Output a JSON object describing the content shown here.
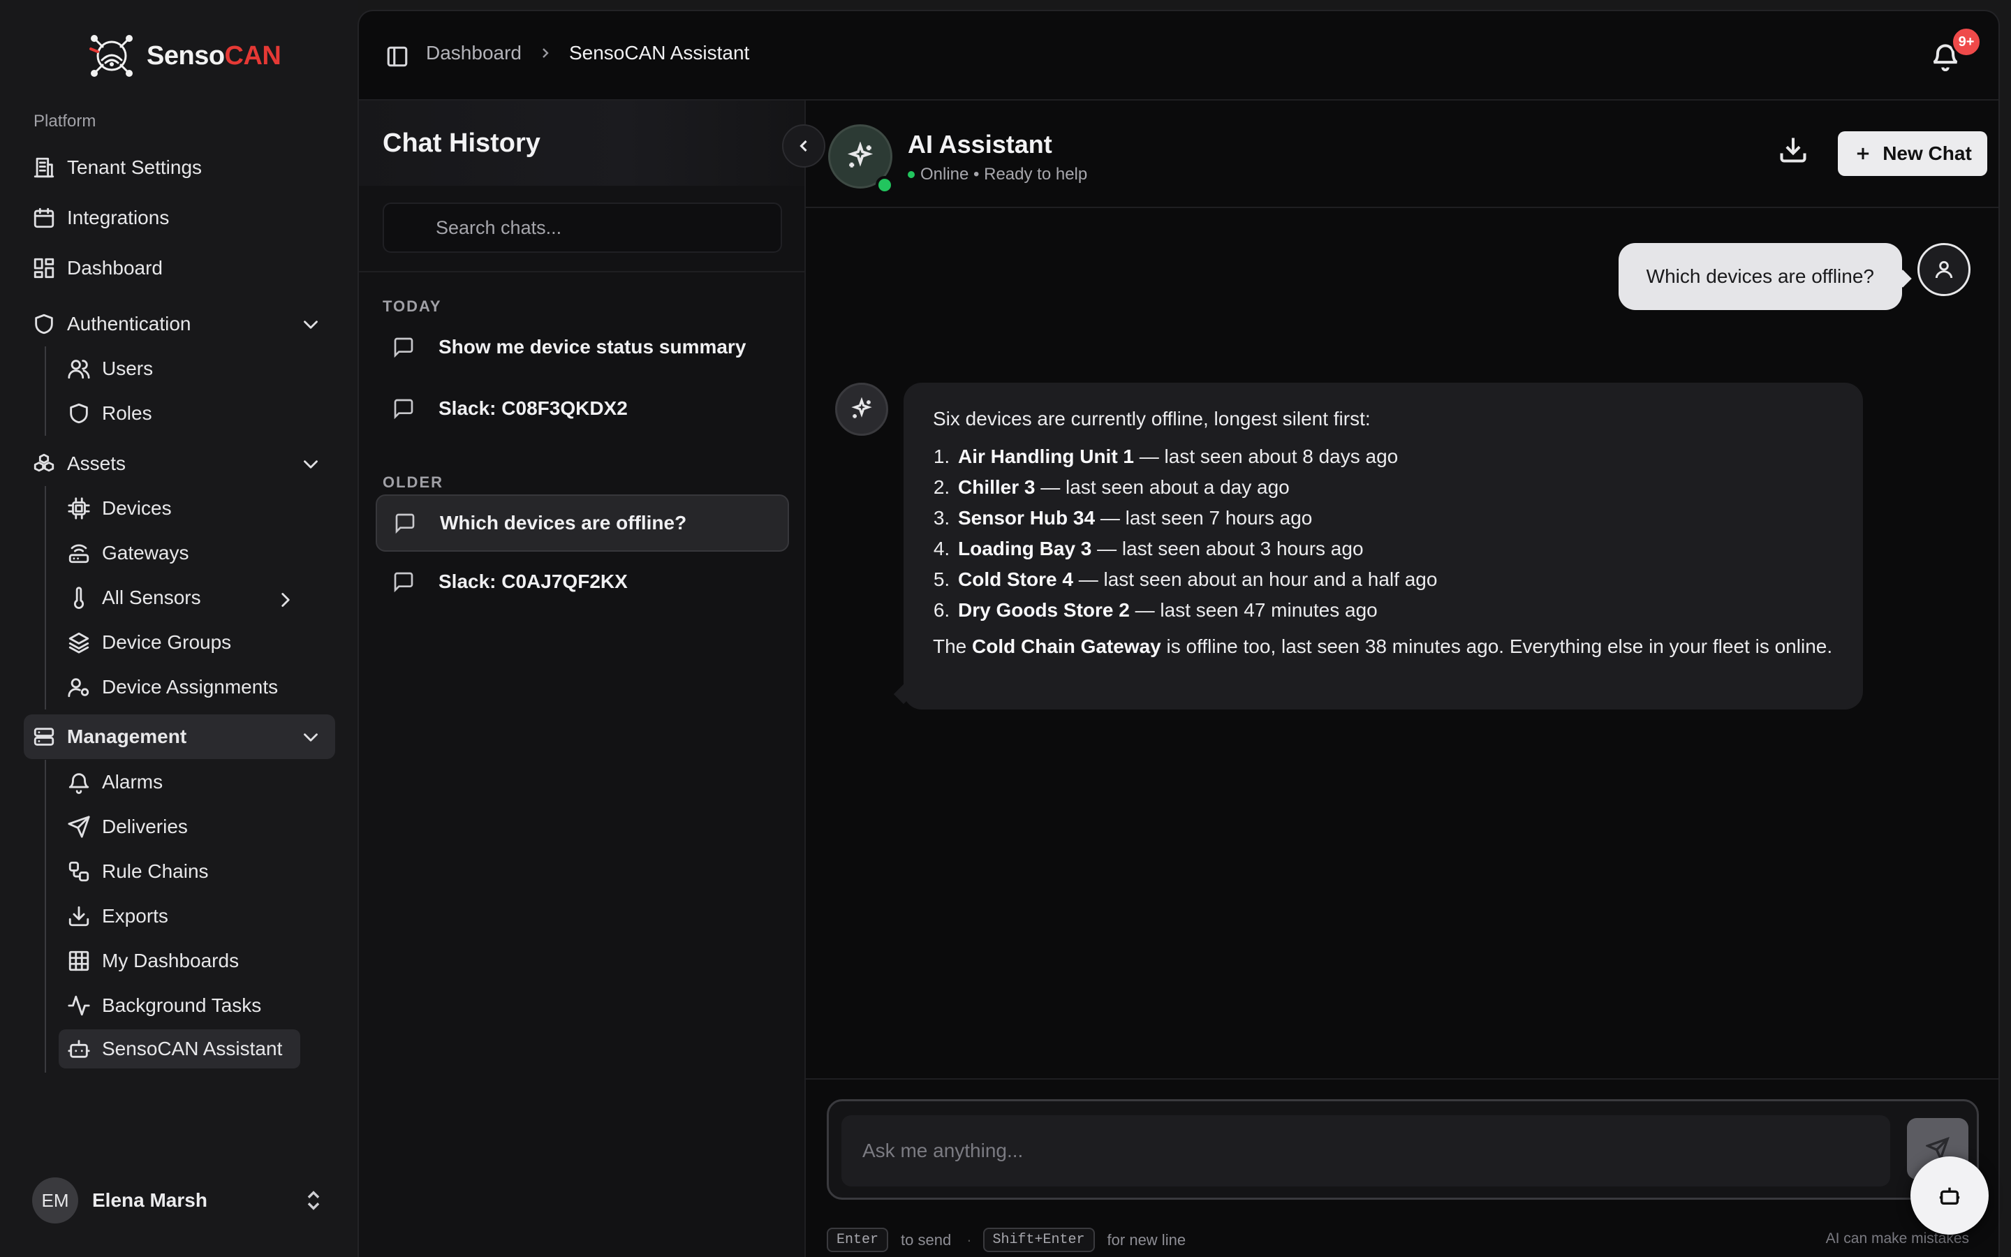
{
  "brand": {
    "name_main": "Senso",
    "name_accent": "CAN",
    "accent_color": "#e53935"
  },
  "sidebar": {
    "section_label": "Platform",
    "items": {
      "tenant_settings": "Tenant Settings",
      "integrations": "Integrations",
      "dashboard": "Dashboard",
      "authentication": "Authentication",
      "users": "Users",
      "roles": "Roles",
      "assets": "Assets",
      "devices": "Devices",
      "gateways": "Gateways",
      "all_sensors": "All Sensors",
      "device_groups": "Device Groups",
      "device_assignments": "Device Assignments",
      "management": "Management",
      "alarms": "Alarms",
      "deliveries": "Deliveries",
      "rule_chains": "Rule Chains",
      "exports": "Exports",
      "my_dashboards": "My Dashboards",
      "background_tasks": "Background Tasks",
      "sensocan_assistant": "SensoCAN Assistant"
    },
    "user": {
      "initials": "EM",
      "name": "Elena Marsh"
    }
  },
  "topbar": {
    "breadcrumb_parent": "Dashboard",
    "breadcrumb_current": "SensoCAN Assistant",
    "notification_badge": "9+"
  },
  "history": {
    "title": "Chat History",
    "search_placeholder": "Search chats...",
    "group_today": "TODAY",
    "group_older": "OLDER",
    "today": [
      "Show me device status summary",
      "Slack: C08F3QKDX2"
    ],
    "older": [
      "Which devices are offline?",
      "Slack: C0AJ7QF2KX"
    ]
  },
  "chat": {
    "assistant_name": "AI Assistant",
    "status": "Online • Ready to help",
    "new_chat_label": "New Chat",
    "user_message": "Which devices are offline?",
    "reply": {
      "intro": "Six devices are currently offline, longest silent first:",
      "items": [
        {
          "name": "Air Handling Unit 1",
          "detail": " — last seen about 8 days ago"
        },
        {
          "name": "Chiller 3",
          "detail": " — last seen about a day ago"
        },
        {
          "name": "Sensor Hub 34",
          "detail": " — last seen 7 hours ago"
        },
        {
          "name": "Loading Bay 3",
          "detail": " — last seen about 3 hours ago"
        },
        {
          "name": "Cold Store 4",
          "detail": " — last seen about an hour and a half ago"
        },
        {
          "name": "Dry Goods Store 2",
          "detail": " — last seen 47 minutes ago"
        }
      ],
      "outro_prefix": "The ",
      "outro_bold": "Cold Chain Gateway",
      "outro_suffix": " is offline too, last seen 38 minutes ago. Everything else in your fleet is online."
    },
    "composer_placeholder": "Ask me anything...",
    "hint_enter_key": "Enter",
    "hint_enter_text": "to send",
    "hint_shift_key": "Shift+Enter",
    "hint_shift_text": "for new line",
    "disclaimer": "AI can make mistakes"
  }
}
